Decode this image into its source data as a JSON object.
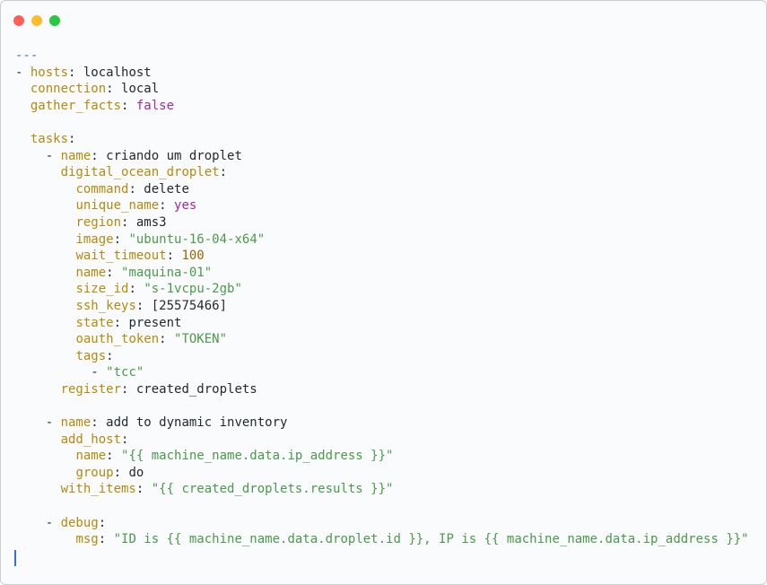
{
  "window": {
    "background": "#fafbfc",
    "controls": {
      "close_color": "#ff5f57",
      "minimize_color": "#febc2e",
      "zoom_color": "#28c840"
    }
  },
  "colors": {
    "key": "#b5890e",
    "plain": "#24292e",
    "string": "#4a9a4a",
    "keyword": "#a626a4",
    "number": "#986801",
    "marker": "#3b6fd1",
    "cursor": "#3b6fd1"
  },
  "lines": [
    [
      {
        "t": "---",
        "c": "marker"
      }
    ],
    [
      {
        "t": "- ",
        "c": "plain"
      },
      {
        "t": "hosts",
        "c": "key"
      },
      {
        "t": ": localhost",
        "c": "plain"
      }
    ],
    [
      {
        "t": "  ",
        "c": "plain"
      },
      {
        "t": "connection",
        "c": "key"
      },
      {
        "t": ": local",
        "c": "plain"
      }
    ],
    [
      {
        "t": "  ",
        "c": "plain"
      },
      {
        "t": "gather_facts",
        "c": "key"
      },
      {
        "t": ": ",
        "c": "plain"
      },
      {
        "t": "false",
        "c": "keyword"
      }
    ],
    [],
    [
      {
        "t": "  ",
        "c": "plain"
      },
      {
        "t": "tasks",
        "c": "key"
      },
      {
        "t": ":",
        "c": "plain"
      }
    ],
    [
      {
        "t": "    - ",
        "c": "plain"
      },
      {
        "t": "name",
        "c": "key"
      },
      {
        "t": ": criando um droplet",
        "c": "plain"
      }
    ],
    [
      {
        "t": "      ",
        "c": "plain"
      },
      {
        "t": "digital_ocean_droplet",
        "c": "key"
      },
      {
        "t": ":",
        "c": "plain"
      }
    ],
    [
      {
        "t": "        ",
        "c": "plain"
      },
      {
        "t": "command",
        "c": "key"
      },
      {
        "t": ": delete",
        "c": "plain"
      }
    ],
    [
      {
        "t": "        ",
        "c": "plain"
      },
      {
        "t": "unique_name",
        "c": "key"
      },
      {
        "t": ": ",
        "c": "plain"
      },
      {
        "t": "yes",
        "c": "keyword"
      }
    ],
    [
      {
        "t": "        ",
        "c": "plain"
      },
      {
        "t": "region",
        "c": "key"
      },
      {
        "t": ": ams3",
        "c": "plain"
      }
    ],
    [
      {
        "t": "        ",
        "c": "plain"
      },
      {
        "t": "image",
        "c": "key"
      },
      {
        "t": ": ",
        "c": "plain"
      },
      {
        "t": "\"ubuntu-16-04-x64\"",
        "c": "string"
      }
    ],
    [
      {
        "t": "        ",
        "c": "plain"
      },
      {
        "t": "wait_timeout",
        "c": "key"
      },
      {
        "t": ": ",
        "c": "plain"
      },
      {
        "t": "100",
        "c": "number"
      }
    ],
    [
      {
        "t": "        ",
        "c": "plain"
      },
      {
        "t": "name",
        "c": "key"
      },
      {
        "t": ": ",
        "c": "plain"
      },
      {
        "t": "\"maquina-01\"",
        "c": "string"
      }
    ],
    [
      {
        "t": "        ",
        "c": "plain"
      },
      {
        "t": "size_id",
        "c": "key"
      },
      {
        "t": ": ",
        "c": "plain"
      },
      {
        "t": "\"s-1vcpu-2gb\"",
        "c": "string"
      }
    ],
    [
      {
        "t": "        ",
        "c": "plain"
      },
      {
        "t": "ssh_keys",
        "c": "key"
      },
      {
        "t": ": [25575466]",
        "c": "plain"
      }
    ],
    [
      {
        "t": "        ",
        "c": "plain"
      },
      {
        "t": "state",
        "c": "key"
      },
      {
        "t": ": present",
        "c": "plain"
      }
    ],
    [
      {
        "t": "        ",
        "c": "plain"
      },
      {
        "t": "oauth_token",
        "c": "key"
      },
      {
        "t": ": ",
        "c": "plain"
      },
      {
        "t": "\"TOKEN\"",
        "c": "string"
      }
    ],
    [
      {
        "t": "        ",
        "c": "plain"
      },
      {
        "t": "tags",
        "c": "key"
      },
      {
        "t": ":",
        "c": "plain"
      }
    ],
    [
      {
        "t": "          - ",
        "c": "plain"
      },
      {
        "t": "\"tcc\"",
        "c": "string"
      }
    ],
    [
      {
        "t": "      ",
        "c": "plain"
      },
      {
        "t": "register",
        "c": "key"
      },
      {
        "t": ": created_droplets",
        "c": "plain"
      }
    ],
    [],
    [
      {
        "t": "    - ",
        "c": "plain"
      },
      {
        "t": "name",
        "c": "key"
      },
      {
        "t": ": add to dynamic inventory",
        "c": "plain"
      }
    ],
    [
      {
        "t": "      ",
        "c": "plain"
      },
      {
        "t": "add_host",
        "c": "key"
      },
      {
        "t": ":",
        "c": "plain"
      }
    ],
    [
      {
        "t": "        ",
        "c": "plain"
      },
      {
        "t": "name",
        "c": "key"
      },
      {
        "t": ": ",
        "c": "plain"
      },
      {
        "t": "\"{{ machine_name.data.ip_address }}\"",
        "c": "string"
      }
    ],
    [
      {
        "t": "        ",
        "c": "plain"
      },
      {
        "t": "group",
        "c": "key"
      },
      {
        "t": ": do",
        "c": "plain"
      }
    ],
    [
      {
        "t": "      ",
        "c": "plain"
      },
      {
        "t": "with_items",
        "c": "key"
      },
      {
        "t": ": ",
        "c": "plain"
      },
      {
        "t": "\"{{ created_droplets.results }}\"",
        "c": "string"
      }
    ],
    [],
    [
      {
        "t": "    - ",
        "c": "plain"
      },
      {
        "t": "debug",
        "c": "key"
      },
      {
        "t": ":",
        "c": "plain"
      }
    ],
    [
      {
        "t": "        ",
        "c": "plain"
      },
      {
        "t": "msg",
        "c": "key"
      },
      {
        "t": ": ",
        "c": "plain"
      },
      {
        "t": "\"ID is {{ machine_name.data.droplet.id }}, IP is {{ machine_name.data.ip_address }}\"",
        "c": "string"
      }
    ]
  ]
}
